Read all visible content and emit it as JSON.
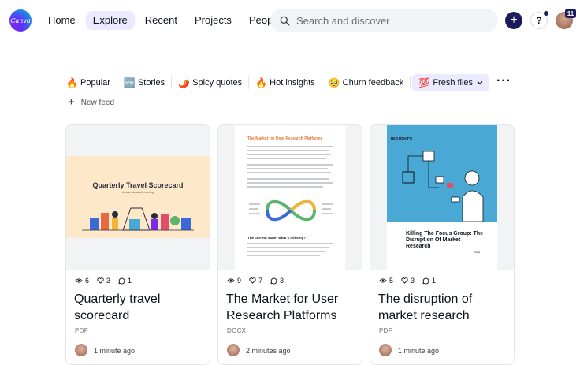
{
  "app": {
    "logo_text": "Canva"
  },
  "nav": {
    "items": [
      {
        "label": "Home",
        "active": false
      },
      {
        "label": "Explore",
        "active": true
      },
      {
        "label": "Recent",
        "active": false
      },
      {
        "label": "Projects",
        "active": false
      },
      {
        "label": "People",
        "active": false
      }
    ]
  },
  "search": {
    "placeholder": "Search and discover",
    "value": ""
  },
  "header": {
    "help_label": "?",
    "notification_count": "11"
  },
  "feeds": {
    "chips": [
      {
        "icon": "🔥",
        "icon_name": "flame-icon",
        "label": "Popular"
      },
      {
        "icon": "🆕",
        "icon_name": "new-icon",
        "label": "Stories"
      },
      {
        "icon": "🌶️",
        "icon_name": "chili-icon",
        "label": "Spicy quotes"
      },
      {
        "icon": "🔥",
        "icon_name": "fire-icon",
        "label": "Hot insights"
      },
      {
        "icon": "🥺",
        "icon_name": "pleading-face-icon",
        "label": "Churn feedback"
      },
      {
        "icon": "💯",
        "icon_name": "hundred-icon",
        "label": "Fresh files",
        "active": true
      }
    ],
    "new_feed_label": "New feed"
  },
  "cards": [
    {
      "views": "6",
      "likes": "3",
      "comments": "1",
      "title": "Quarterly travel scorecard",
      "type": "PDF",
      "time": "1 minute ago",
      "thumb": {
        "heading": "Quarterly Travel Scorecard",
        "subheading": "A view into what's coming"
      }
    },
    {
      "views": "9",
      "likes": "7",
      "comments": "3",
      "title": "The Market for User Research Platforms",
      "type": "DOCX",
      "time": "2 minutes ago",
      "thumb": {
        "heading": "The Market for User Research Platforms",
        "subheading": "The current state: what's missing?"
      }
    },
    {
      "views": "5",
      "likes": "3",
      "comments": "1",
      "title": "The disruption of market research",
      "type": "PDF",
      "time": "1 minute ago",
      "thumb": {
        "brand": "INSIGHTS",
        "heading": "Killing The Focus Group: The Disruption Of Market Research",
        "year": "2024"
      }
    }
  ],
  "colors": {
    "accent": "#1c1b5e",
    "active_bg": "#ebeaff",
    "thumb_blue": "#4aa9d4",
    "thumb_peach": "#fde8c9"
  }
}
